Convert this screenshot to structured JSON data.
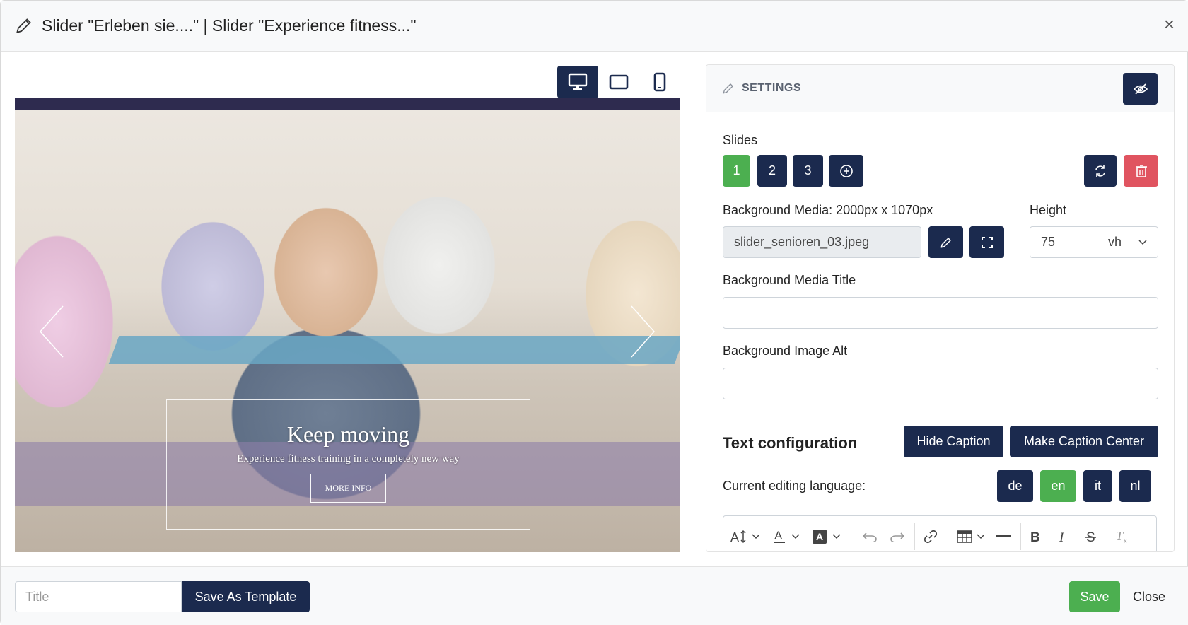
{
  "modal": {
    "title": "Slider \"Erleben sie....\" | Slider \"Experience fitness...\"",
    "close_glyph": "×"
  },
  "device_switcher": [
    {
      "name": "desktop",
      "icon": "monitor-icon",
      "active": true
    },
    {
      "name": "tablet",
      "icon": "tablet-icon",
      "active": false
    },
    {
      "name": "mobile",
      "icon": "phone-icon",
      "active": false
    }
  ],
  "preview": {
    "caption_title": "Keep moving",
    "caption_subtitle": "Experience fitness training in a completely new way",
    "caption_button": "MORE INFO"
  },
  "settings": {
    "title": "SETTINGS",
    "slides_label": "Slides",
    "slides": [
      "1",
      "2",
      "3"
    ],
    "active_slide": "1",
    "bg_media_label": "Background Media: 2000px x 1070px",
    "bg_media_value": "slider_senioren_03.jpeg",
    "height_label": "Height",
    "height_value": "75",
    "height_unit": "vh",
    "bg_media_title_label": "Background Media Title",
    "bg_media_title_value": "",
    "bg_image_alt_label": "Background Image Alt",
    "bg_image_alt_value": "",
    "text_config_heading": "Text configuration",
    "hide_caption_btn": "Hide Caption",
    "center_caption_btn": "Make Caption Center",
    "lang_label": "Current editing language:",
    "languages": [
      "de",
      "en",
      "it",
      "nl"
    ],
    "active_language": "en"
  },
  "footer": {
    "title_placeholder": "Title",
    "save_template_btn": "Save As Template",
    "save_btn": "Save",
    "close_btn": "Close"
  },
  "colors": {
    "navy": "#1b2a4e",
    "green": "#4caf50",
    "red": "#e05460"
  }
}
